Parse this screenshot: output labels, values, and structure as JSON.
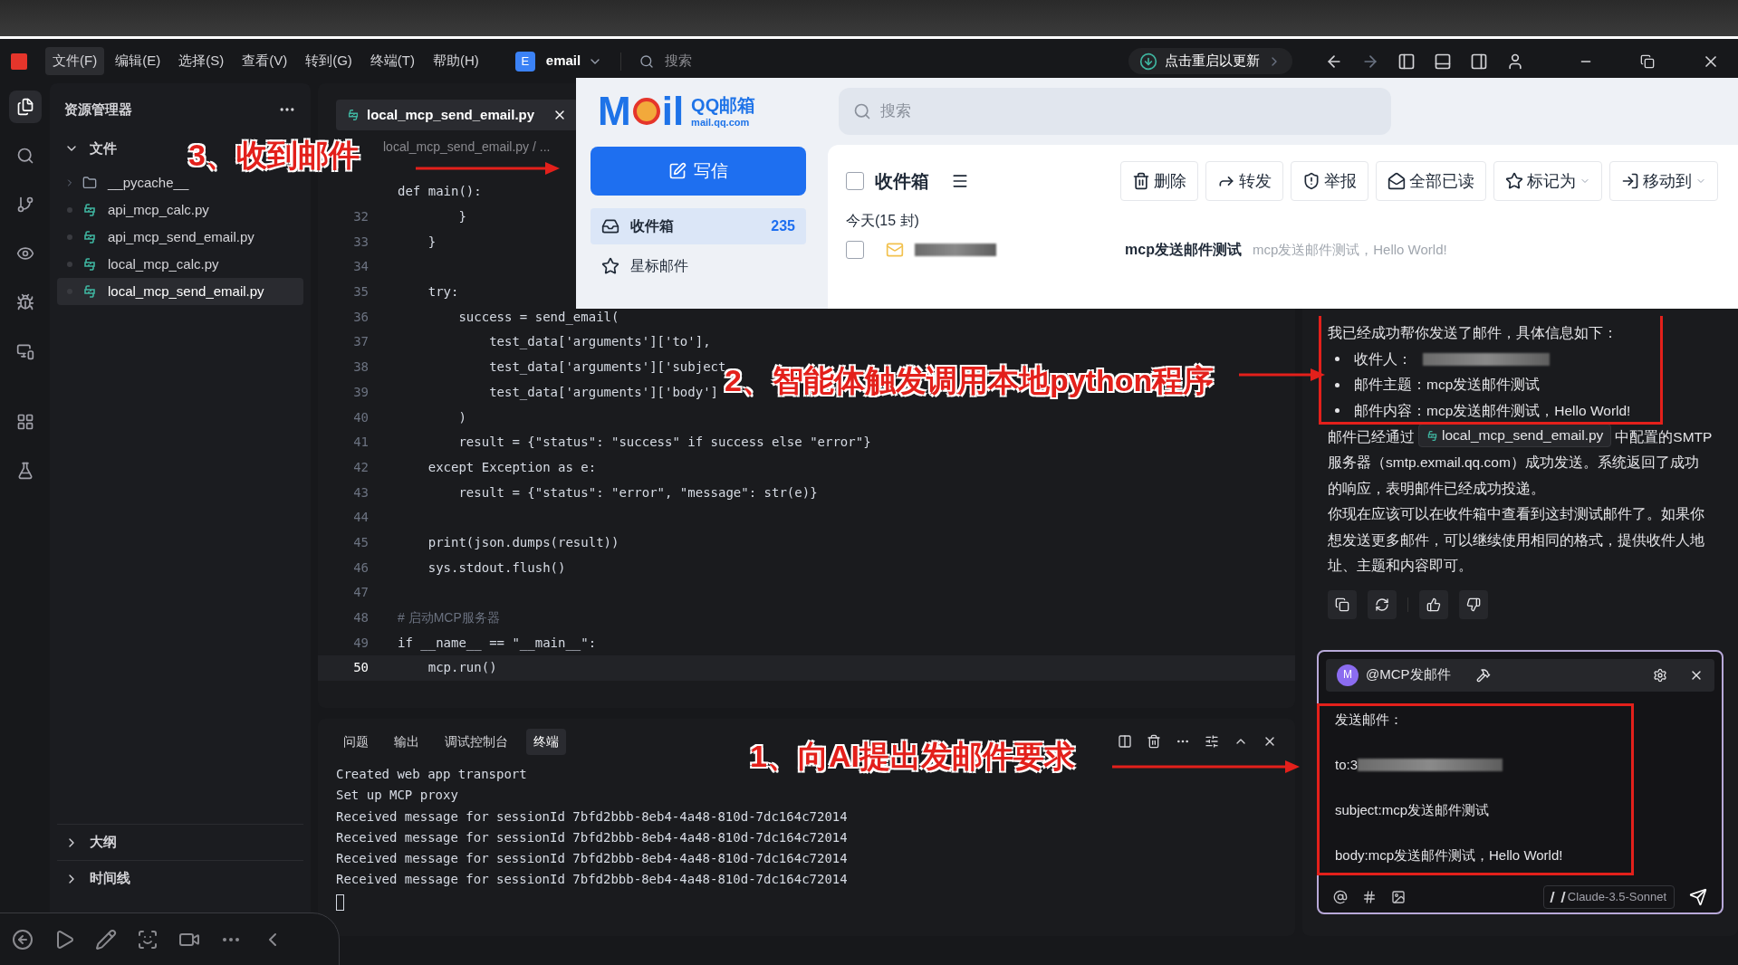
{
  "menu_bar": {
    "items": [
      {
        "label": "文件(F)",
        "selected": true
      },
      {
        "label": "编辑(E)",
        "selected": false
      },
      {
        "label": "选择(S)",
        "selected": false
      },
      {
        "label": "查看(V)",
        "selected": false
      },
      {
        "label": "转到(G)",
        "selected": false
      },
      {
        "label": "终端(T)",
        "selected": false
      },
      {
        "label": "帮助(H)",
        "selected": false
      }
    ],
    "workspace": {
      "badge": "E",
      "name": "email"
    },
    "search": {
      "placeholder": "搜索"
    },
    "update_button": "点击重启以更新"
  },
  "activity_bar": [
    {
      "kind": "files",
      "selected": true
    },
    {
      "kind": "search",
      "selected": false
    },
    {
      "kind": "branch",
      "selected": false
    },
    {
      "kind": "eye",
      "selected": false
    },
    {
      "kind": "bug",
      "selected": false
    },
    {
      "kind": "remote",
      "selected": false
    },
    {
      "kind": "grid",
      "selected": false
    },
    {
      "kind": "flask",
      "selected": false
    }
  ],
  "explorer": {
    "title": "资源管理器",
    "section": {
      "label": "文件",
      "expanded": true,
      "children": [
        {
          "name": "__pycache__",
          "kind": "folder",
          "selected": false
        },
        {
          "name": "api_mcp_calc.py",
          "kind": "python",
          "selected": false
        },
        {
          "name": "api_mcp_send_email.py",
          "kind": "python",
          "selected": false
        },
        {
          "name": "local_mcp_calc.py",
          "kind": "python",
          "selected": false
        },
        {
          "name": "local_mcp_send_email.py",
          "kind": "python",
          "selected": true
        }
      ]
    },
    "bottom_sections": [
      {
        "label": "大纲",
        "expanded": false
      },
      {
        "label": "时间线",
        "expanded": false
      }
    ]
  },
  "editor": {
    "tabs": [
      {
        "label": "local_mcp_send_email.py",
        "selected": true
      }
    ],
    "breadcrumb": "local_mcp_send_email.py / ...",
    "lines": [
      {
        "text": "def main():",
        "kind": "code",
        "current": false
      },
      {
        "number": "32",
        "text": "        }",
        "kind": "code",
        "current": false
      },
      {
        "number": "33",
        "text": "    }",
        "kind": "code",
        "current": false
      },
      {
        "number": "34",
        "kind": "code",
        "current": false
      },
      {
        "number": "35",
        "text": "    try:",
        "kind": "code",
        "current": false
      },
      {
        "number": "36",
        "text": "        success = send_email(",
        "kind": "code",
        "current": false
      },
      {
        "number": "37",
        "text": "            test_data['arguments']['to'],",
        "kind": "code",
        "current": false
      },
      {
        "number": "38",
        "text": "            test_data['arguments']['subject",
        "kind": "code",
        "current": false
      },
      {
        "number": "39",
        "text": "            test_data['arguments']['body']",
        "kind": "code",
        "current": false
      },
      {
        "number": "40",
        "text": "        )",
        "kind": "code",
        "current": false
      },
      {
        "number": "41",
        "text": "        result = {\"status\": \"success\" if success else \"error\"}",
        "kind": "code",
        "current": false
      },
      {
        "number": "42",
        "text": "    except Exception as e:",
        "kind": "code",
        "current": false
      },
      {
        "number": "43",
        "text": "        result = {\"status\": \"error\", \"message\": str(e)}",
        "kind": "code",
        "current": false
      },
      {
        "number": "44",
        "kind": "code",
        "current": false
      },
      {
        "number": "45",
        "text": "    print(json.dumps(result))",
        "kind": "code",
        "current": false
      },
      {
        "number": "46",
        "text": "    sys.stdout.flush()",
        "kind": "code",
        "current": false
      },
      {
        "number": "47",
        "kind": "code",
        "current": false
      },
      {
        "number": "48",
        "text": "# 启动MCP服务器",
        "kind": "comment",
        "current": false
      },
      {
        "number": "49",
        "text": "if __name__ == \"__main__\":",
        "kind": "code",
        "current": false
      },
      {
        "number": "50",
        "text": "    mcp.run()",
        "kind": "code",
        "current": true
      }
    ]
  },
  "terminal": {
    "tabs": [
      {
        "label": "问题",
        "selected": false
      },
      {
        "label": "输出",
        "selected": false
      },
      {
        "label": "调试控制台",
        "selected": false
      },
      {
        "label": "终端",
        "selected": true
      }
    ],
    "lines": [
      "Created web app transport",
      "Set up MCP proxy",
      "Received message for sessionId 7bfd2bbb-8eb4-4a48-810d-7dc164c72014",
      "Received message for sessionId 7bfd2bbb-8eb4-4a48-810d-7dc164c72014",
      "Received message for sessionId 7bfd2bbb-8eb4-4a48-810d-7dc164c72014",
      "Received message for sessionId 7bfd2bbb-8eb4-4a48-810d-7dc164c72014"
    ]
  },
  "mail": {
    "logo_start": "M",
    "logo_end": "il",
    "logo_name": "QQ邮箱",
    "logo_domain": "mail.qq.com",
    "search": {
      "placeholder": "搜索"
    },
    "compose": "写信",
    "folders": [
      {
        "label": "收件箱",
        "count": "235",
        "kind": "inbox",
        "selected": true
      },
      {
        "label": "星标邮件",
        "kind": "star",
        "selected": false
      }
    ],
    "folder_title": "收件箱",
    "select_all_checked": false,
    "actions": [
      {
        "label": "删除",
        "kind": "trash",
        "dropdown": false
      },
      {
        "label": "转发",
        "kind": "forward",
        "dropdown": false
      },
      {
        "label": "举报",
        "kind": "shield",
        "dropdown": false
      },
      {
        "label": "全部已读",
        "kind": "read",
        "dropdown": false
      },
      {
        "label": "标记为",
        "kind": "star",
        "dropdown": true
      },
      {
        "label": "移动到",
        "kind": "move",
        "dropdown": true
      }
    ],
    "group": "今天(15 封)",
    "messages": [
      {
        "subject": "mcp发送邮件测试",
        "preview": "mcp发送邮件测试，Hello World!",
        "checked": false
      }
    ]
  },
  "chat": {
    "intro": "我已经成功帮你发送了邮件，具体信息如下：",
    "bullets": [
      {
        "label": "收件人：",
        "redacted": true
      },
      {
        "label": "邮件主题：",
        "value": "mcp发送邮件测试",
        "redacted": false
      },
      {
        "label": "邮件内容：",
        "value": "mcp发送邮件测试，Hello World!",
        "redacted": false
      }
    ],
    "para_before": "邮件已经通过",
    "file_chip": "local_mcp_send_email.py",
    "para_after": "中配置的SMTP服务器（smtp.exmail.qq.com）成功发送。系统返回了成功的响应，表明邮件已经成功投递。",
    "closing": "你现在应该可以在收件箱中查看到这封测试邮件了。如果你想发送更多邮件，可以继续使用相同的格式，提供收件人地址、主题和内容即可。",
    "composer": {
      "avatar": "M",
      "agent": "@MCP发邮件",
      "lines": [
        {
          "text": "发送邮件：",
          "redacted": false
        },
        {
          "text": "to:3",
          "redacted": true
        },
        {
          "text": "subject:mcp发送邮件测试",
          "redacted": false
        },
        {
          "text": "body:mcp发送邮件测试，Hello World!",
          "redacted": false
        }
      ],
      "model": "Claude-3.5-Sonnet"
    }
  },
  "annotations": [
    {
      "text": "3、收到邮件"
    },
    {
      "text": "2、智能体触发调用本地python程序"
    },
    {
      "text": "1、向AI提出发邮件要求"
    }
  ]
}
